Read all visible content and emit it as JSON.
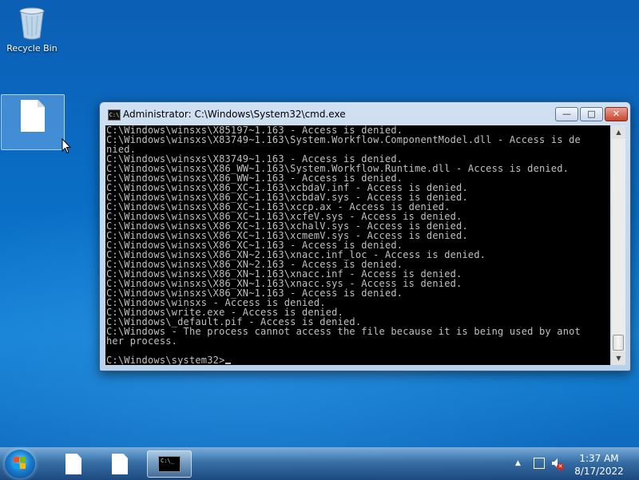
{
  "desktop": {
    "recycle_bin_label": "Recycle Bin"
  },
  "window": {
    "title": "Administrator: C:\\Windows\\System32\\cmd.exe",
    "console_lines": [
      "C:\\Windows\\winsxs\\X85197~1.163 - Access is denied.",
      "C:\\Windows\\winsxs\\X83749~1.163\\System.Workflow.ComponentModel.dll - Access is de",
      "nied.",
      "C:\\Windows\\winsxs\\X83749~1.163 - Access is denied.",
      "C:\\Windows\\winsxs\\X86_WW~1.163\\System.Workflow.Runtime.dll - Access is denied.",
      "C:\\Windows\\winsxs\\X86_WW~1.163 - Access is denied.",
      "C:\\Windows\\winsxs\\X86_XC~1.163\\xcbdaV.inf - Access is denied.",
      "C:\\Windows\\winsxs\\X86_XC~1.163\\xcbdaV.sys - Access is denied.",
      "C:\\Windows\\winsxs\\X86_XC~1.163\\xccp.ax - Access is denied.",
      "C:\\Windows\\winsxs\\X86_XC~1.163\\xcfeV.sys - Access is denied.",
      "C:\\Windows\\winsxs\\X86_XC~1.163\\xchalV.sys - Access is denied.",
      "C:\\Windows\\winsxs\\X86_XC~1.163\\xcmemV.sys - Access is denied.",
      "C:\\Windows\\winsxs\\X86_XC~1.163 - Access is denied.",
      "C:\\Windows\\winsxs\\X86_XN~2.163\\xnacc.inf_loc - Access is denied.",
      "C:\\Windows\\winsxs\\X86_XN~2.163 - Access is denied.",
      "C:\\Windows\\winsxs\\X86_XN~1.163\\xnacc.inf - Access is denied.",
      "C:\\Windows\\winsxs\\X86_XN~1.163\\xnacc.sys - Access is denied.",
      "C:\\Windows\\winsxs\\X86_XN~1.163 - Access is denied.",
      "C:\\Windows\\winsxs - Access is denied.",
      "C:\\Windows\\write.exe - Access is denied.",
      "C:\\Windows\\_default.pif - Access is denied.",
      "C:\\Windows - The process cannot access the file because it is being used by anot",
      "her process."
    ],
    "prompt": "C:\\Windows\\system32>"
  },
  "taskbar": {
    "clock_time": "1:37 AM",
    "clock_date": "8/17/2022"
  },
  "icons": {
    "recycle_bin": "recycle-bin-icon",
    "file": "file-icon",
    "cmd": "cmd-icon",
    "start": "windows-start-icon",
    "network": "network-icon",
    "volume": "volume-muted-icon"
  },
  "colors": {
    "console_bg": "#000000",
    "console_fg": "#c0c0c0",
    "close_button": "#c9442c",
    "desktop_blue": "#0a6fc7"
  }
}
